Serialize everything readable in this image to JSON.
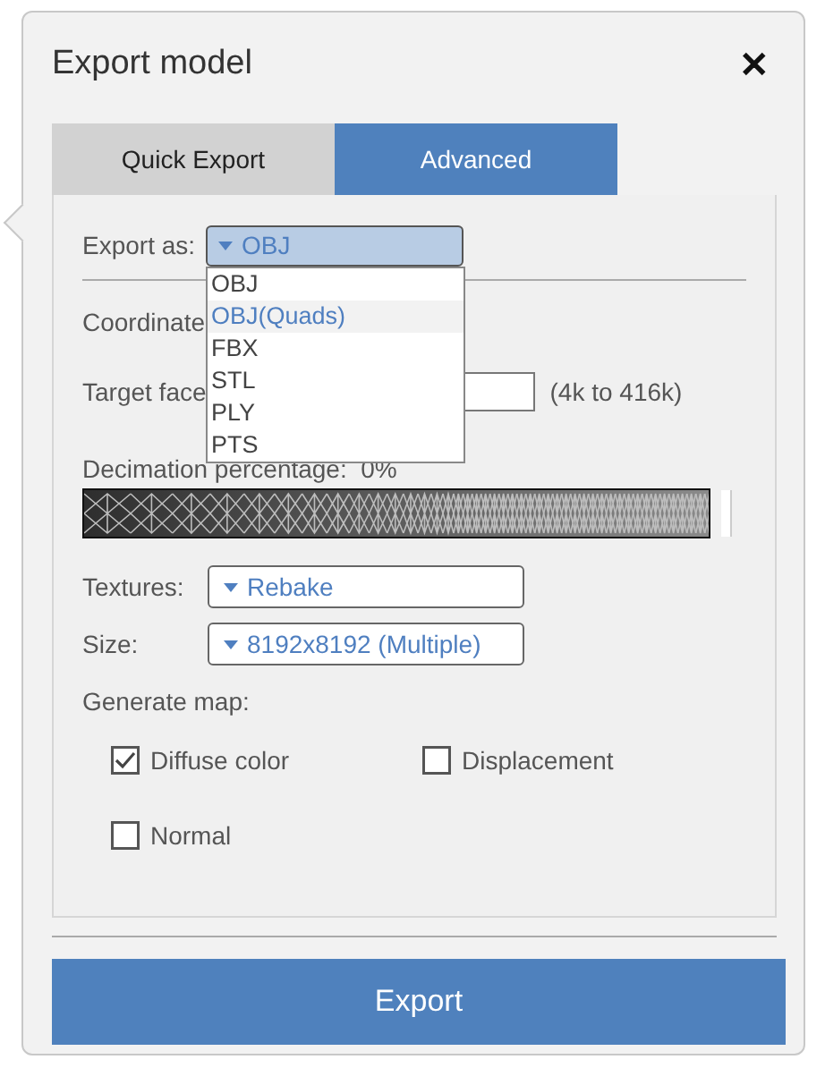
{
  "dialog": {
    "title": "Export model",
    "close": "✕"
  },
  "tabs": [
    {
      "label": "Quick Export",
      "selected": false
    },
    {
      "label": "Advanced",
      "selected": true
    }
  ],
  "export_as": {
    "label": "Export as:",
    "value": "OBJ",
    "expanded": true,
    "options": [
      {
        "label": "OBJ",
        "highlighted": false
      },
      {
        "label": "OBJ(Quads)",
        "highlighted": true
      },
      {
        "label": "FBX",
        "highlighted": false
      },
      {
        "label": "STL",
        "highlighted": false
      },
      {
        "label": "PLY",
        "highlighted": false
      },
      {
        "label": "PTS",
        "highlighted": false
      }
    ]
  },
  "coordinate": {
    "label": "Coordinate"
  },
  "target_faces": {
    "label": "Target face",
    "range": "(4k to 416k)"
  },
  "decimation": {
    "label": "Decimation percentage:  0%"
  },
  "textures": {
    "label": "Textures:",
    "value": "Rebake"
  },
  "size": {
    "label": "Size:",
    "value": "8192x8192 (Multiple)"
  },
  "generate_map": {
    "label": "Generate map:",
    "options": [
      {
        "label": "Diffuse color",
        "checked": true
      },
      {
        "label": "Displacement",
        "checked": false
      },
      {
        "label": "Normal",
        "checked": false
      }
    ]
  },
  "export_button": "Export"
}
